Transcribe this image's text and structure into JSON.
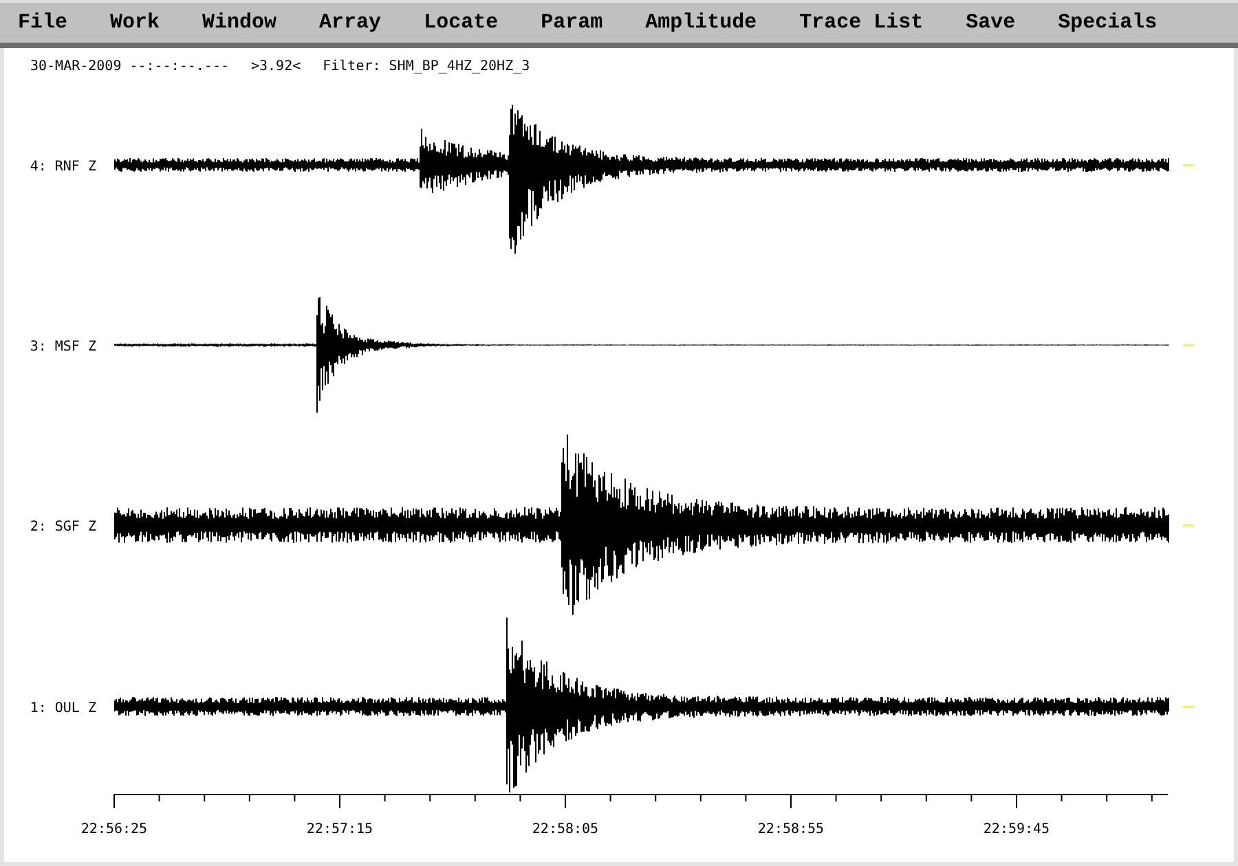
{
  "menu": [
    {
      "label": "File"
    },
    {
      "label": "Work"
    },
    {
      "label": "Window"
    },
    {
      "label": "Array"
    },
    {
      "label": "Locate"
    },
    {
      "label": "Param"
    },
    {
      "label": "Amplitude"
    },
    {
      "label": "Trace List"
    },
    {
      "label": "Save"
    },
    {
      "label": "Specials"
    }
  ],
  "header": {
    "datetime": "30-MAR-2009 --:--:--.---",
    "amplitude": ">3.92<",
    "filter": "Filter: SHM_BP_4HZ_20HZ_3"
  },
  "traces": [
    {
      "label": "4: RNF Z"
    },
    {
      "label": "3: MSF Z"
    },
    {
      "label": "2: SGF Z"
    },
    {
      "label": "1: OUL Z"
    }
  ],
  "time_axis": [
    "22:56:25",
    "22:57:15",
    "22:58:05",
    "22:58:55",
    "22:59:45"
  ]
}
